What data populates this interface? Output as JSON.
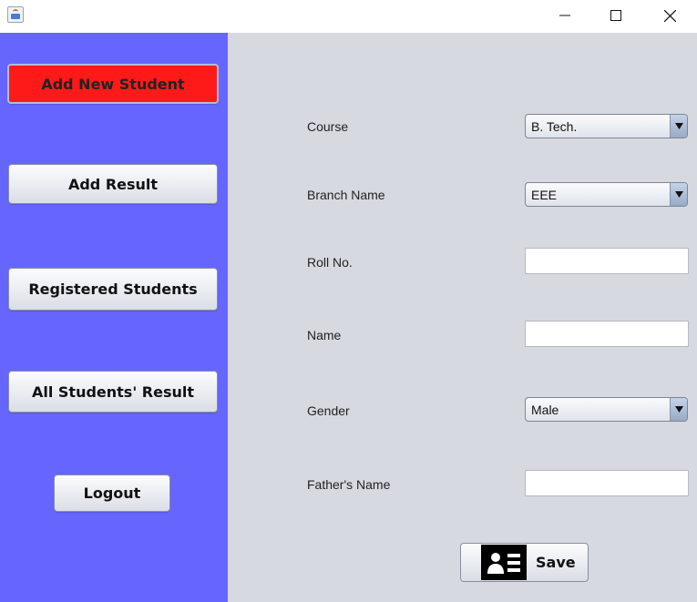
{
  "window": {
    "title": "",
    "controls": {
      "minimize": "minimize-icon",
      "maximize": "maximize-icon",
      "close": "close-icon"
    }
  },
  "sidebar": {
    "background": "#6666ff",
    "active_color": "#ff1a1a",
    "items": [
      {
        "label": "Add New Student",
        "active": true
      },
      {
        "label": "Add Result",
        "active": false
      },
      {
        "label": "Registered Students",
        "active": false
      },
      {
        "label": "All Students' Result",
        "active": false
      },
      {
        "label": "Logout",
        "active": false
      }
    ]
  },
  "form": {
    "background": "#d6d9e0",
    "course": {
      "label": "Course",
      "value": "B. Tech."
    },
    "branch": {
      "label": "Branch Name",
      "value": "EEE"
    },
    "roll_no": {
      "label": "Roll No.",
      "value": ""
    },
    "name": {
      "label": "Name",
      "value": ""
    },
    "gender": {
      "label": "Gender",
      "value": "Male"
    },
    "father_name": {
      "label": "Father's Name",
      "value": ""
    },
    "save": {
      "label": "Save",
      "icon": "contact-card-icon"
    }
  }
}
